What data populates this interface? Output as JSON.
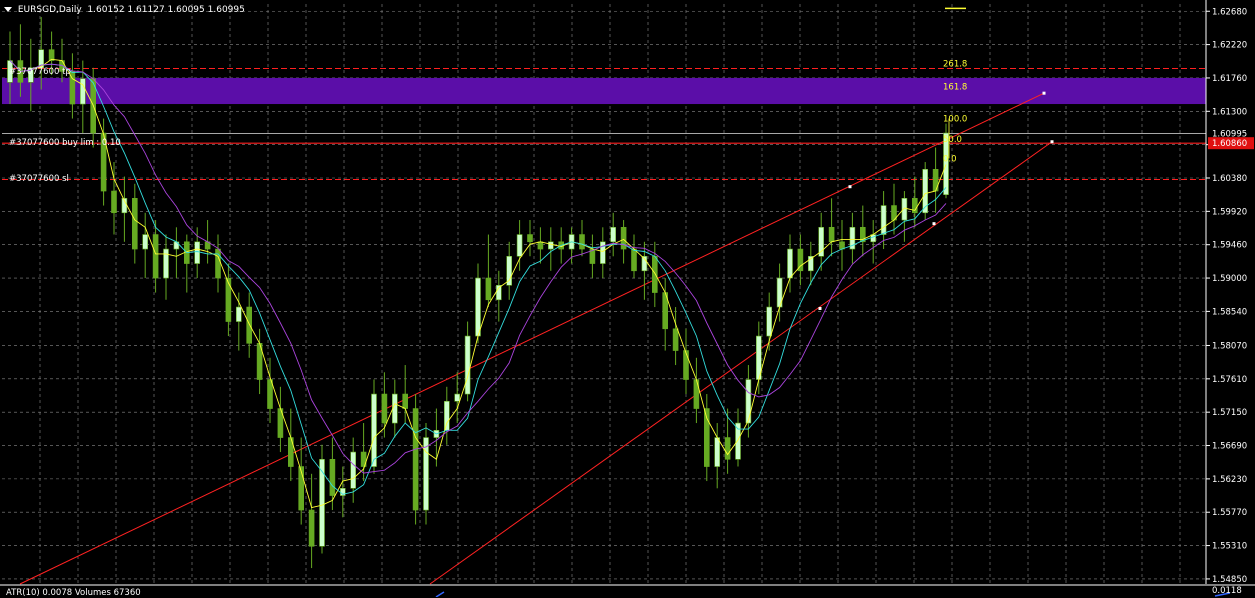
{
  "header": {
    "symbol": "EURSGD,Daily",
    "ohlc": "1.60152 1.61127 1.60095 1.60995"
  },
  "price_axis": {
    "ticks": [
      "1.62680",
      "1.62220",
      "1.61760",
      "1.61300",
      "1.60840",
      "1.60380",
      "1.59920",
      "1.59460",
      "1.59000",
      "1.58540",
      "1.58070",
      "1.57610",
      "1.57150",
      "1.56690",
      "1.56230",
      "1.55770",
      "1.55310",
      "1.54850"
    ],
    "current_price": "1.60995",
    "order_price": "1.60860"
  },
  "orders": {
    "take_profit": "#37077600 tp",
    "buy_limit": "#37077600 buy lim : 0.10",
    "stop_loss": "#37077600 sl"
  },
  "fibonacci": {
    "levels": [
      "261.8",
      "161.8",
      "100.0",
      "50.0",
      "0.0"
    ]
  },
  "indicator": {
    "label": "ATR(10) 0.0078  Volumes 67360",
    "max_label": "0.0118"
  },
  "colors": {
    "background": "#000000",
    "grid": "#8a8a8a",
    "candle_bull": "#ccffcc",
    "candle_bear": "#66aa22",
    "ma_fast": "#ffff33",
    "ma_mid": "#33dddd",
    "ma_slow": "#aa44dd",
    "trendline": "#ff2222",
    "fib_zone": "#5b0ea8",
    "fib_text": "#ffff33",
    "order_line": "#ff2020",
    "current_price_line": "#c0c0c0"
  },
  "chart_data": {
    "type": "candlestick",
    "title": "EURSGD,Daily",
    "ylim": [
      1.5478,
      1.6278
    ],
    "grid": true,
    "ohlc": [
      [
        1.617,
        1.624,
        1.614,
        1.62
      ],
      [
        1.62,
        1.625,
        1.615,
        1.617
      ],
      [
        1.617,
        1.623,
        1.613,
        1.619
      ],
      [
        1.619,
        1.626,
        1.616,
        1.6215
      ],
      [
        1.6215,
        1.624,
        1.618,
        1.62
      ],
      [
        1.62,
        1.623,
        1.617,
        1.6185
      ],
      [
        1.6185,
        1.621,
        1.612,
        1.614
      ],
      [
        1.614,
        1.62,
        1.61,
        1.6175
      ],
      [
        1.6175,
        1.619,
        1.608,
        1.61
      ],
      [
        1.61,
        1.612,
        1.6,
        1.602
      ],
      [
        1.602,
        1.606,
        1.596,
        1.599
      ],
      [
        1.599,
        1.604,
        1.595,
        1.601
      ],
      [
        1.601,
        1.603,
        1.592,
        1.594
      ],
      [
        1.594,
        1.599,
        1.59,
        1.596
      ],
      [
        1.596,
        1.598,
        1.588,
        1.59
      ],
      [
        1.59,
        1.596,
        1.587,
        1.594
      ],
      [
        1.594,
        1.597,
        1.59,
        1.595
      ],
      [
        1.595,
        1.596,
        1.588,
        1.592
      ],
      [
        1.592,
        1.597,
        1.59,
        1.595
      ],
      [
        1.595,
        1.598,
        1.592,
        1.594
      ],
      [
        1.594,
        1.596,
        1.588,
        1.59
      ],
      [
        1.59,
        1.592,
        1.582,
        1.584
      ],
      [
        1.584,
        1.588,
        1.58,
        1.586
      ],
      [
        1.586,
        1.588,
        1.579,
        1.581
      ],
      [
        1.581,
        1.583,
        1.574,
        1.576
      ],
      [
        1.576,
        1.579,
        1.57,
        1.572
      ],
      [
        1.572,
        1.575,
        1.566,
        1.568
      ],
      [
        1.568,
        1.572,
        1.562,
        1.564
      ],
      [
        1.564,
        1.568,
        1.556,
        1.558
      ],
      [
        1.558,
        1.563,
        1.55,
        1.553
      ],
      [
        1.553,
        1.567,
        1.552,
        1.565
      ],
      [
        1.565,
        1.568,
        1.558,
        1.56
      ],
      [
        1.56,
        1.564,
        1.557,
        1.561
      ],
      [
        1.561,
        1.568,
        1.559,
        1.566
      ],
      [
        1.566,
        1.57,
        1.562,
        1.564
      ],
      [
        1.564,
        1.576,
        1.563,
        1.574
      ],
      [
        1.574,
        1.577,
        1.568,
        1.57
      ],
      [
        1.57,
        1.576,
        1.568,
        1.574
      ],
      [
        1.574,
        1.578,
        1.57,
        1.572
      ],
      [
        1.572,
        1.574,
        1.556,
        1.558
      ],
      [
        1.558,
        1.57,
        1.556,
        1.568
      ],
      [
        1.568,
        1.572,
        1.564,
        1.569
      ],
      [
        1.569,
        1.575,
        1.567,
        1.573
      ],
      [
        1.573,
        1.577,
        1.57,
        1.574
      ],
      [
        1.574,
        1.584,
        1.573,
        1.582
      ],
      [
        1.582,
        1.592,
        1.581,
        1.59
      ],
      [
        1.59,
        1.596,
        1.586,
        1.587
      ],
      [
        1.587,
        1.591,
        1.584,
        1.589
      ],
      [
        1.589,
        1.595,
        1.587,
        1.593
      ],
      [
        1.593,
        1.598,
        1.591,
        1.596
      ],
      [
        1.596,
        1.598,
        1.593,
        1.595
      ],
      [
        1.595,
        1.597,
        1.592,
        1.594
      ],
      [
        1.594,
        1.597,
        1.591,
        1.595
      ],
      [
        1.595,
        1.597,
        1.592,
        1.594
      ],
      [
        1.594,
        1.597,
        1.592,
        1.596
      ],
      [
        1.596,
        1.598,
        1.593,
        1.594
      ],
      [
        1.594,
        1.596,
        1.59,
        1.592
      ],
      [
        1.592,
        1.597,
        1.59,
        1.595
      ],
      [
        1.595,
        1.599,
        1.593,
        1.597
      ],
      [
        1.597,
        1.598,
        1.592,
        1.594
      ],
      [
        1.594,
        1.596,
        1.59,
        1.591
      ],
      [
        1.591,
        1.595,
        1.587,
        1.593
      ],
      [
        1.593,
        1.595,
        1.586,
        1.588
      ],
      [
        1.588,
        1.59,
        1.58,
        1.583
      ],
      [
        1.583,
        1.586,
        1.578,
        1.58
      ],
      [
        1.58,
        1.583,
        1.574,
        1.576
      ],
      [
        1.576,
        1.579,
        1.57,
        1.572
      ],
      [
        1.572,
        1.574,
        1.562,
        1.564
      ],
      [
        1.564,
        1.57,
        1.561,
        1.568
      ],
      [
        1.568,
        1.572,
        1.563,
        1.565
      ],
      [
        1.565,
        1.572,
        1.564,
        1.57
      ],
      [
        1.57,
        1.578,
        1.568,
        1.576
      ],
      [
        1.576,
        1.584,
        1.574,
        1.582
      ],
      [
        1.582,
        1.588,
        1.58,
        1.586
      ],
      [
        1.586,
        1.592,
        1.584,
        1.59
      ],
      [
        1.59,
        1.596,
        1.588,
        1.594
      ],
      [
        1.594,
        1.596,
        1.589,
        1.591
      ],
      [
        1.591,
        1.595,
        1.589,
        1.593
      ],
      [
        1.593,
        1.599,
        1.591,
        1.597
      ],
      [
        1.597,
        1.601,
        1.593,
        1.595
      ],
      [
        1.595,
        1.598,
        1.591,
        1.594
      ],
      [
        1.594,
        1.599,
        1.592,
        1.597
      ],
      [
        1.597,
        1.6,
        1.593,
        1.595
      ],
      [
        1.595,
        1.598,
        1.592,
        1.596
      ],
      [
        1.596,
        1.602,
        1.594,
        1.6
      ],
      [
        1.6,
        1.603,
        1.596,
        1.598
      ],
      [
        1.598,
        1.602,
        1.595,
        1.601
      ],
      [
        1.601,
        1.604,
        1.597,
        1.599
      ],
      [
        1.599,
        1.606,
        1.598,
        1.605
      ],
      [
        1.605,
        1.608,
        1.599,
        1.602
      ],
      [
        1.6015,
        1.6113,
        1.601,
        1.61
      ]
    ],
    "moving_averages": [
      "fast",
      "mid",
      "slow"
    ],
    "fib_levels": [
      261.8,
      161.8,
      100.0,
      50.0,
      0.0
    ],
    "indicator": {
      "name": "ATR(10)",
      "value": 0.0078,
      "volume": 67360,
      "max": 0.0118
    }
  }
}
